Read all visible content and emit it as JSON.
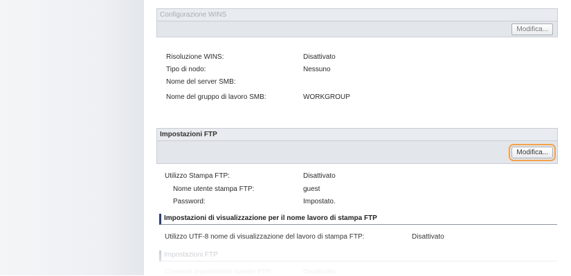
{
  "wins": {
    "title": "Configurazione WINS",
    "edit_label": "Modifica...",
    "rows": [
      {
        "label": "Risoluzione WINS:",
        "value": "Disattivato"
      },
      {
        "label": "Tipo di nodo:",
        "value": "Nessuno"
      },
      {
        "label": "Nome del server SMB:",
        "value": ""
      },
      {
        "label": "Nome del gruppo di lavoro SMB:",
        "value": "WORKGROUP"
      }
    ]
  },
  "ftp": {
    "title": "Impostazioni FTP",
    "edit_label": "Modifica...",
    "rows": [
      {
        "label": "Utilizzo Stampa FTP:",
        "value": "Disattivato"
      },
      {
        "label": "Nome utente stampa FTP:",
        "value": "guest"
      },
      {
        "label": "Password:",
        "value": "Impostato."
      }
    ],
    "display_settings": {
      "title": "Impostazioni di visualizzazione per il nome lavoro di stampa FTP",
      "row_label": "Utilizzo UTF-8 nome di visualizzazione del lavoro di stampa FTP:",
      "row_value": "Disattivato"
    },
    "ftp_settings": {
      "title": "Impostazioni FTP",
      "row_label": "Consenti impostazioni tramite FTP:",
      "row_value": "Disattivato"
    }
  }
}
